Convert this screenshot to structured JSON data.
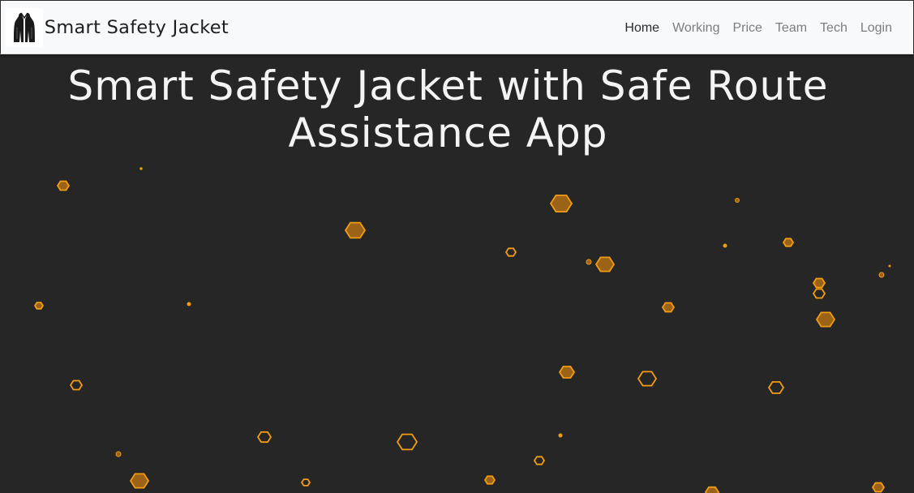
{
  "navbar": {
    "brand_name": "Smart Safety Jacket",
    "logo_icon": "jacket-icon",
    "links": [
      {
        "label": "Home",
        "active": true
      },
      {
        "label": "Working",
        "active": false
      },
      {
        "label": "Price",
        "active": false
      },
      {
        "label": "Team",
        "active": false
      },
      {
        "label": "Tech",
        "active": false
      },
      {
        "label": "Login",
        "active": false
      }
    ]
  },
  "hero": {
    "title": "Smart Safety Jacket with Safe Route Assistance App",
    "particle_icon": "hexagon-icon"
  },
  "colors": {
    "background": "#262626",
    "navbar_bg": "#f8f9fa",
    "accent": "#f39c12",
    "accent_fill": "#9a6318",
    "title": "#f4f4f4"
  }
}
